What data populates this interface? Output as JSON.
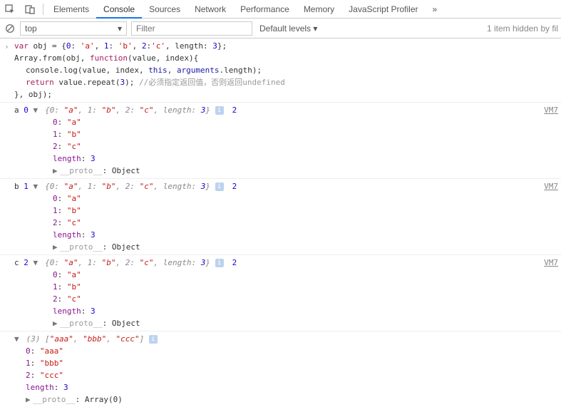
{
  "toolbar": {
    "tabs": [
      "Elements",
      "Console",
      "Sources",
      "Network",
      "Performance",
      "Memory",
      "JavaScript Profiler"
    ],
    "active": 1,
    "more": "»"
  },
  "filterbar": {
    "context": "top",
    "filter_placeholder": "Filter",
    "levels": "Default levels ▾",
    "hidden": "1 item hidden by fil"
  },
  "code": {
    "l1a": "var",
    "l1b": " obj = {",
    "l1c": "0",
    "l1d": ": ",
    "l1e": "'a'",
    "l1f": ", ",
    "l1g": "1",
    "l1h": ": ",
    "l1i": "'b'",
    "l1j": ", ",
    "l1k": "2",
    "l1l": ":",
    "l1m": "'c'",
    "l1n": ", length: ",
    "l1o": "3",
    "l1p": "};",
    "l2a": "Array.from(obj, ",
    "l2b": "function",
    "l2c": "(value, index){",
    "l3a": "console.log(value, index, ",
    "l3b": "this",
    "l3c": ", ",
    "l3d": "arguments",
    "l3e": ".length);",
    "l4a": "return",
    "l4b": " value.repeat(",
    "l4c": "3",
    "l4d": "); ",
    "l4e": "//必须指定返回值，否则返回undefined",
    "l5": "}, obj);"
  },
  "groups": [
    {
      "pfx": "a ",
      "idx": "0",
      "trail": "2",
      "link": "VM7"
    },
    {
      "pfx": "b ",
      "idx": "1",
      "trail": "2",
      "link": "VM7"
    },
    {
      "pfx": "c ",
      "idx": "2",
      "trail": "2",
      "link": "VM7"
    }
  ],
  "objsum": {
    "open": "{",
    "k0": "0: ",
    "v0": "\"a\"",
    "s0": ", ",
    "k1": "1: ",
    "v1": "\"b\"",
    "s1": ", ",
    "k2": "2: ",
    "v2": "\"c\"",
    "s2": ", ",
    "kl": "length: ",
    "vl": "3",
    "close": "}"
  },
  "props": {
    "p0k": "0",
    "p0c": ": ",
    "p0v": "\"a\"",
    "p1k": "1",
    "p1c": ": ",
    "p1v": "\"b\"",
    "p2k": "2",
    "p2c": ": ",
    "p2v": "\"c\"",
    "plk": "length",
    "plc": ": ",
    "plv": "3",
    "prk": "__proto__",
    "prc": ": ",
    "prv": "Object"
  },
  "result": {
    "count": "(3)",
    "open": " [",
    "a": "\"aaa\"",
    "s0": ", ",
    "b": "\"bbb\"",
    "s1": ", ",
    "c": "\"ccc\"",
    "close": "]",
    "r0k": "0",
    "r0c": ": ",
    "r0v": "\"aaa\"",
    "r1k": "1",
    "r1c": ": ",
    "r1v": "\"bbb\"",
    "r2k": "2",
    "r2c": ": ",
    "r2v": "\"ccc\"",
    "rlk": "length",
    "rlc": ": ",
    "rlv": "3",
    "rpk": "__proto__",
    "rpc": ": ",
    "rpv": "Array(0)"
  },
  "glyph": {
    "tri_down": "▼",
    "tri_right": "▶",
    "info": "i"
  }
}
